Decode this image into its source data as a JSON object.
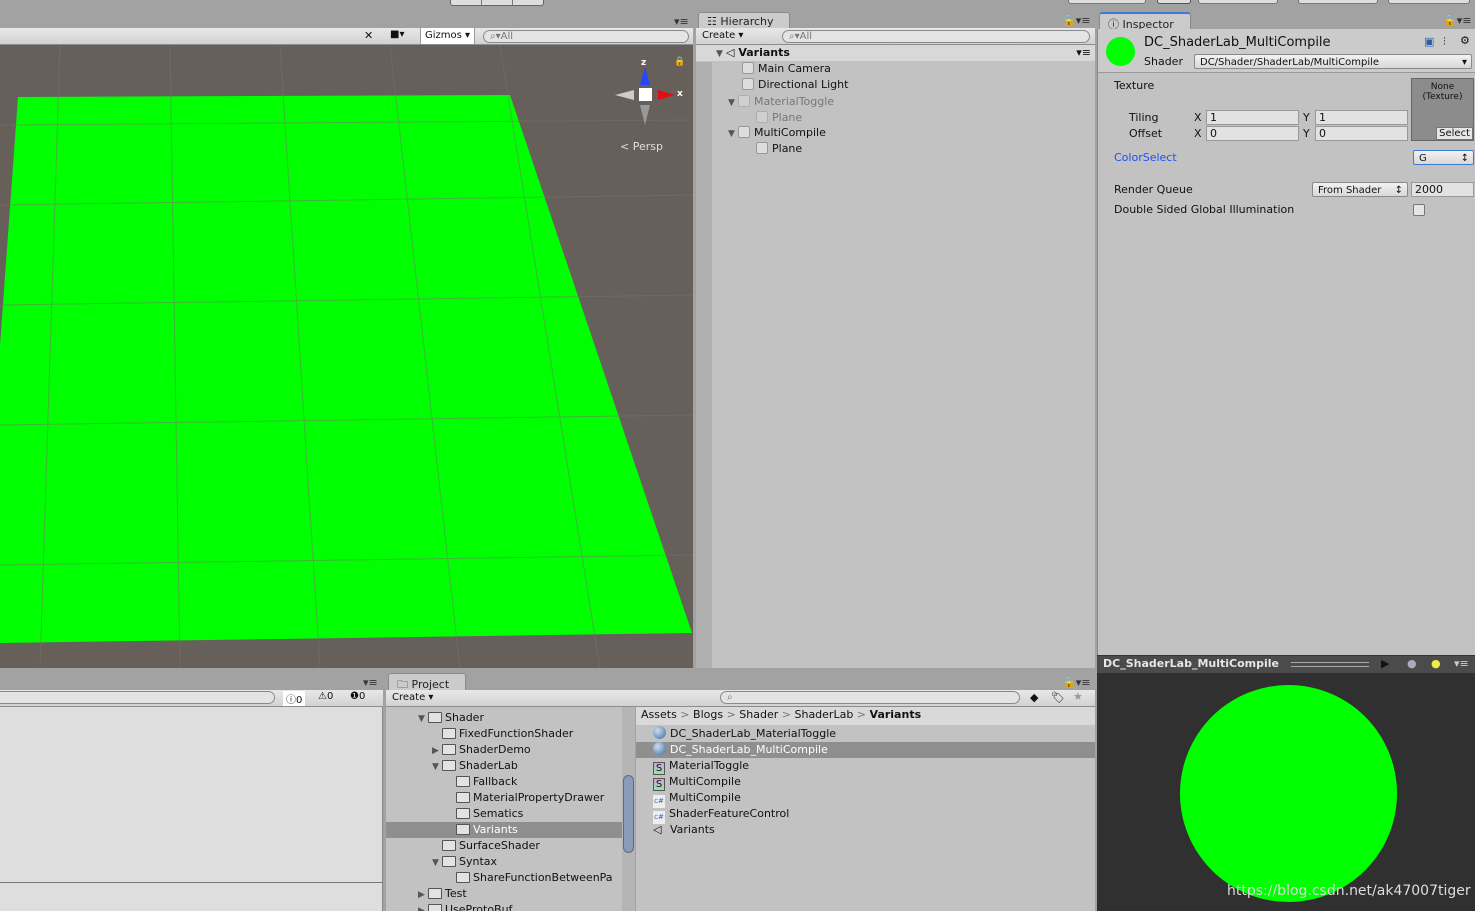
{
  "scene": {
    "gizmos_label": "Gizmos",
    "search_placeholder": "All",
    "axis_z": "z",
    "axis_x": "x",
    "persp_label": "Persp",
    "plane_color": "#00ff00",
    "bg_color": "#675f5a"
  },
  "hierarchy": {
    "tab": "Hierarchy",
    "create": "Create",
    "search_placeholder": "All",
    "scene": "Variants",
    "items": [
      {
        "label": "Main Camera",
        "dim": false
      },
      {
        "label": "Directional Light",
        "dim": false
      },
      {
        "label": "MaterialToggle",
        "dim": true
      },
      {
        "label": "Plane",
        "dim": true
      },
      {
        "label": "MultiCompile",
        "dim": false
      },
      {
        "label": "Plane",
        "dim": false
      }
    ]
  },
  "inspector": {
    "tab": "Inspector",
    "material_name": "DC_ShaderLab_MultiCompile",
    "shader_label": "Shader",
    "shader_value": "DC/Shader/ShaderLab/MultiCompile",
    "texture_label": "Texture",
    "texture_slot": "None (Texture)",
    "select": "Select",
    "tiling_label": "Tiling",
    "offset_label": "Offset",
    "x": "X",
    "y": "Y",
    "tiling_x": "1",
    "tiling_y": "1",
    "offset_x": "0",
    "offset_y": "0",
    "color_select_label": "ColorSelect",
    "color_select_value": "G",
    "render_queue_label": "Render Queue",
    "render_queue_mode": "From Shader",
    "render_queue_value": "2000",
    "dsgi_label": "Double Sided Global Illumination",
    "dsgi_checked": false,
    "swatch_color": "#00ff00"
  },
  "preview": {
    "title": "DC_ShaderLab_MultiCompile",
    "sphere_color": "#00ff00"
  },
  "console": {
    "info_count": "0",
    "warn_count": "0",
    "error_count": "0"
  },
  "project": {
    "tab": "Project",
    "create": "Create",
    "tree": [
      {
        "label": "Shader",
        "depth": 0,
        "arrow": "▼"
      },
      {
        "label": "FixedFunctionShader",
        "depth": 1,
        "arrow": ""
      },
      {
        "label": "ShaderDemo",
        "depth": 1,
        "arrow": "▶"
      },
      {
        "label": "ShaderLab",
        "depth": 1,
        "arrow": "▼"
      },
      {
        "label": "Fallback",
        "depth": 2,
        "arrow": ""
      },
      {
        "label": "MaterialPropertyDrawer",
        "depth": 2,
        "arrow": ""
      },
      {
        "label": "Sematics",
        "depth": 2,
        "arrow": ""
      },
      {
        "label": "Variants",
        "depth": 2,
        "arrow": "",
        "selected": true
      },
      {
        "label": "SurfaceShader",
        "depth": 1,
        "arrow": ""
      },
      {
        "label": "Syntax",
        "depth": 1,
        "arrow": "▼"
      },
      {
        "label": "ShareFunctionBetweenPa",
        "depth": 2,
        "arrow": ""
      },
      {
        "label": "Test",
        "depth": 0,
        "arrow": "▶"
      },
      {
        "label": "UseProtoBuf",
        "depth": 0,
        "arrow": "▶"
      }
    ],
    "breadcrumb": [
      "Assets",
      "Blogs",
      "Shader",
      "ShaderLab",
      "Variants"
    ],
    "files": [
      {
        "label": "DC_ShaderLab_MaterialToggle",
        "icon": "material"
      },
      {
        "label": "DC_ShaderLab_MultiCompile",
        "icon": "material",
        "selected": true
      },
      {
        "label": "MaterialToggle",
        "icon": "shader"
      },
      {
        "label": "MultiCompile",
        "icon": "shader"
      },
      {
        "label": "MultiCompile",
        "icon": "csharp"
      },
      {
        "label": "ShaderFeatureControl",
        "icon": "csharp"
      },
      {
        "label": "Variants",
        "icon": "unity-scene"
      }
    ]
  },
  "watermark": "https://blog.csdn.net/ak47007tiger"
}
